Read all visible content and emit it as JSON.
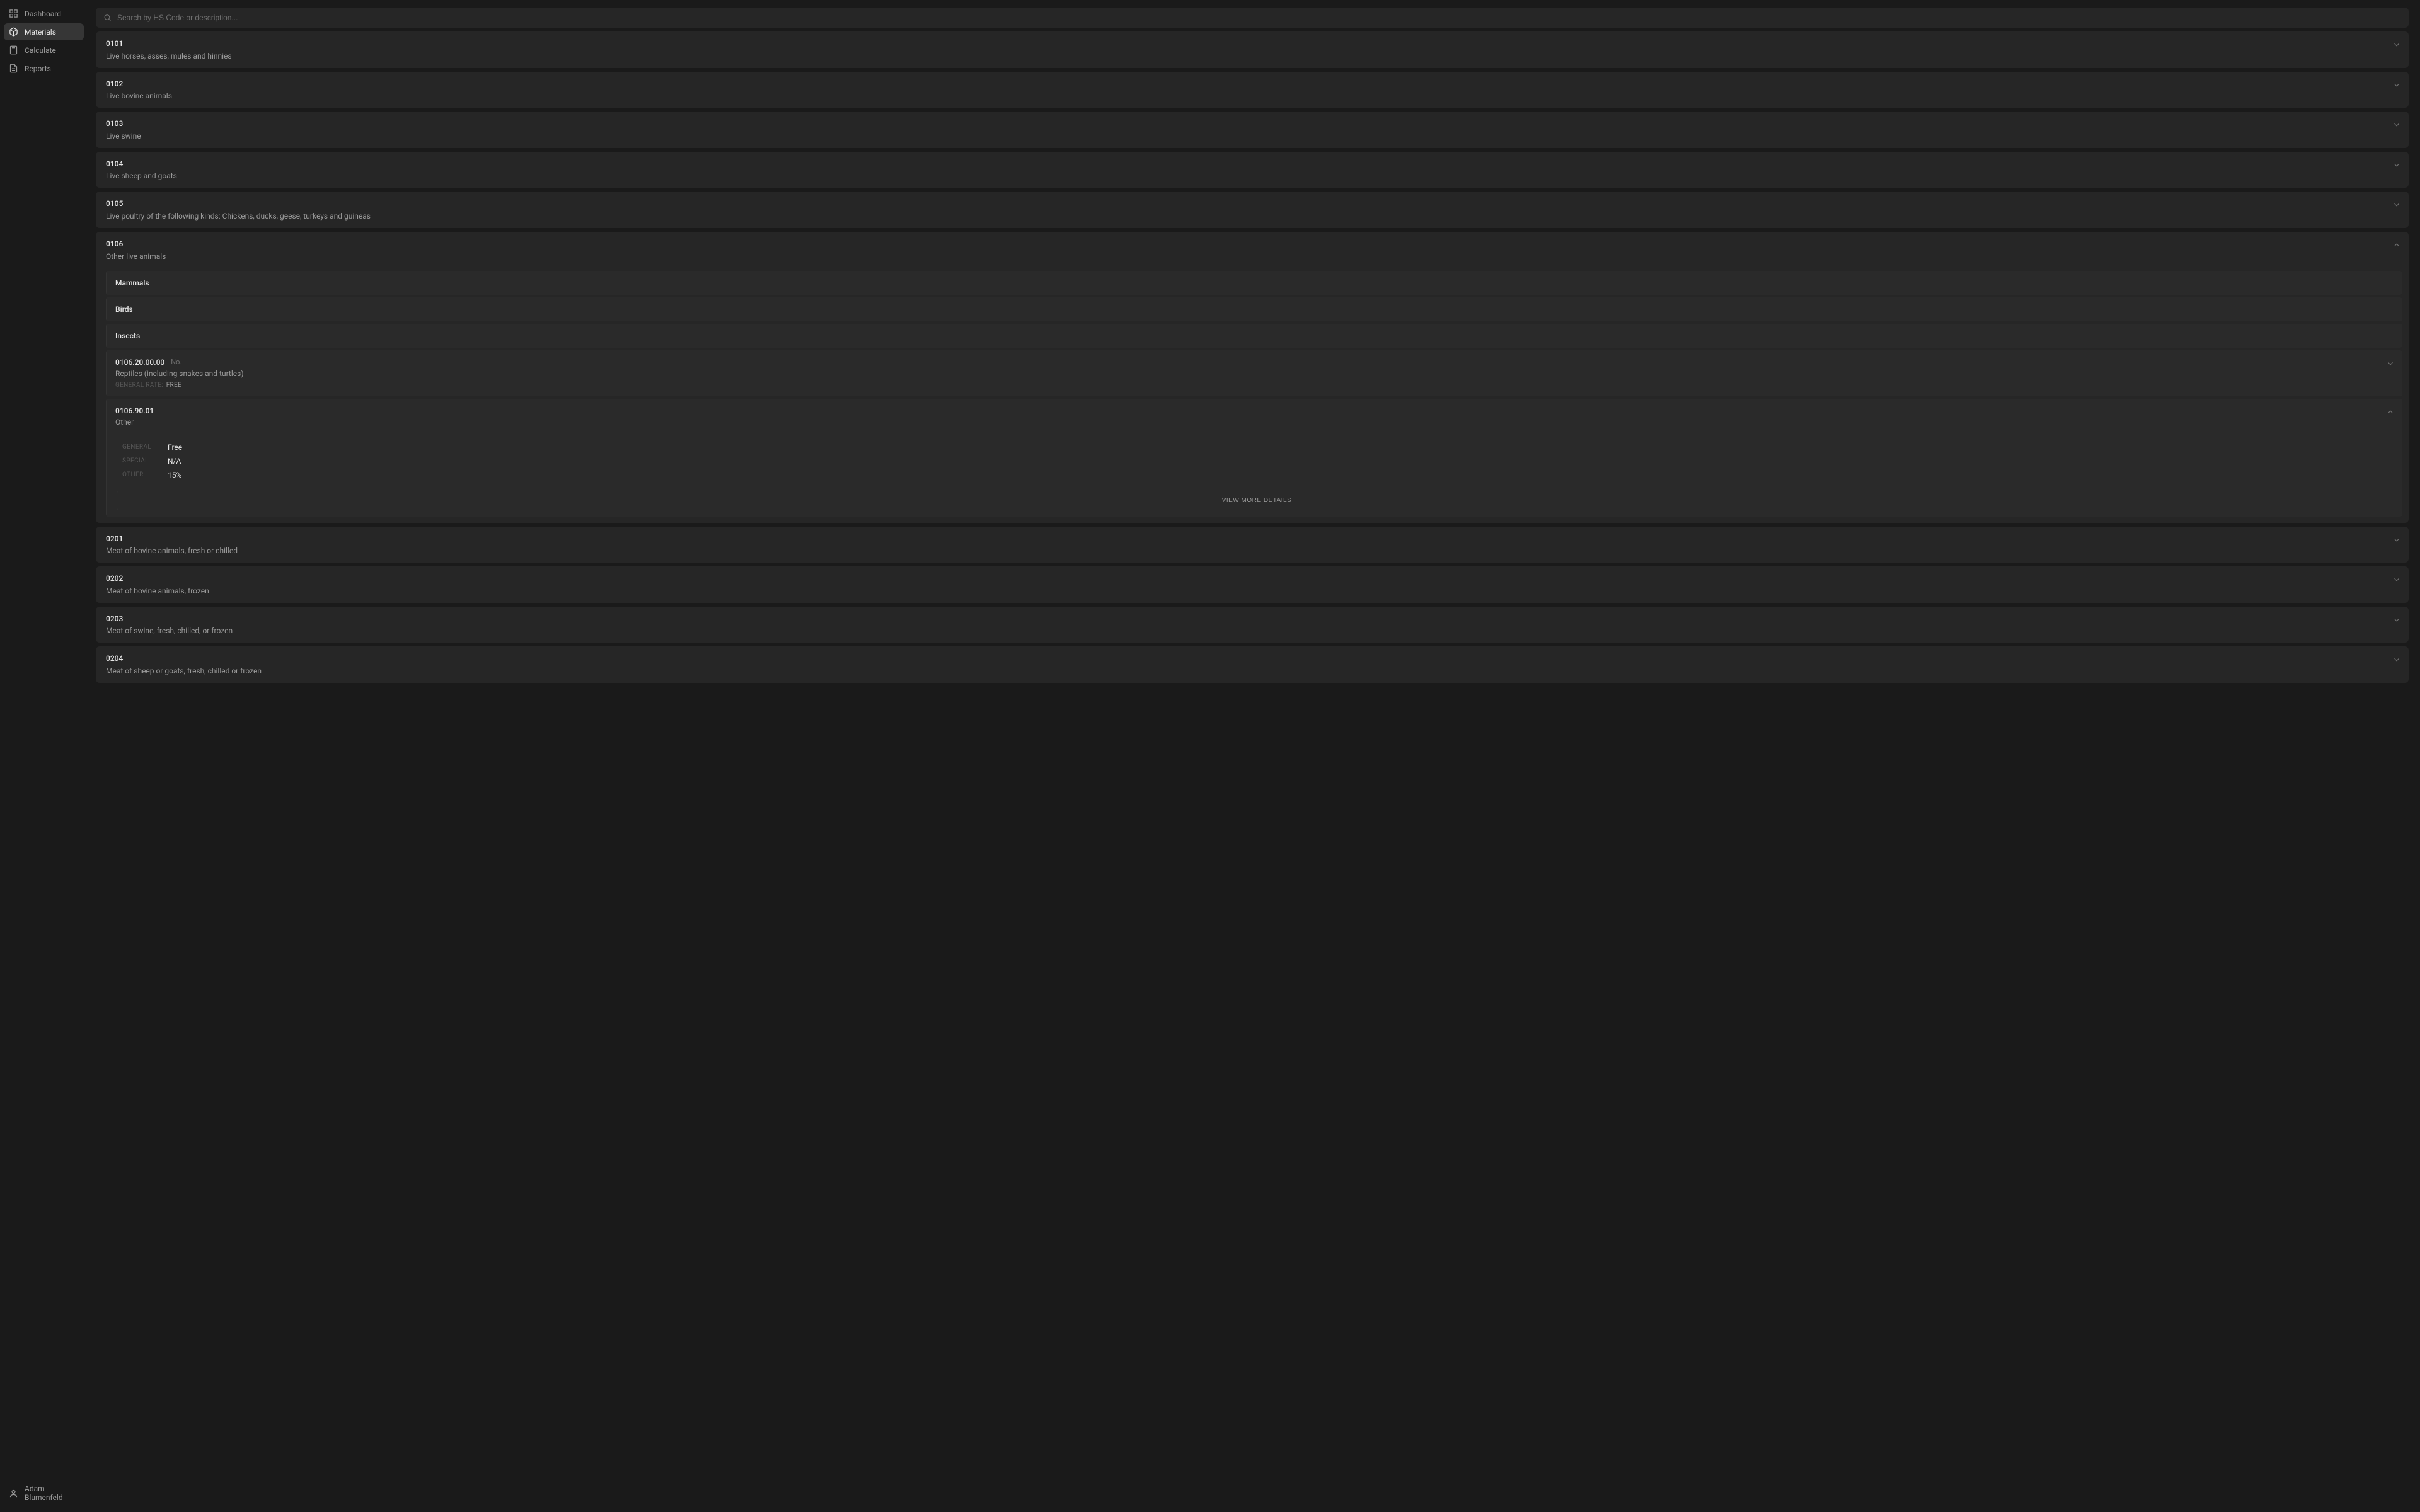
{
  "sidebar": {
    "items": [
      {
        "label": "Dashboard",
        "icon": "dashboard-icon",
        "active": false
      },
      {
        "label": "Materials",
        "icon": "box-icon",
        "active": true
      },
      {
        "label": "Calculate",
        "icon": "calculator-icon",
        "active": false
      },
      {
        "label": "Reports",
        "icon": "file-icon",
        "active": false
      }
    ],
    "user": {
      "name": "Adam Blumenfeld"
    }
  },
  "search": {
    "placeholder": "Search by HS Code or description..."
  },
  "categories": [
    {
      "code": "0101",
      "desc": "Live horses, asses, mules and hinnies",
      "expanded": false
    },
    {
      "code": "0102",
      "desc": "Live bovine animals",
      "expanded": false
    },
    {
      "code": "0103",
      "desc": "Live swine",
      "expanded": false
    },
    {
      "code": "0104",
      "desc": "Live sheep and goats",
      "expanded": false
    },
    {
      "code": "0105",
      "desc": "Live poultry of the following kinds: Chickens, ducks, geese, turkeys and guineas",
      "expanded": false
    },
    {
      "code": "0106",
      "desc": "Other live animals",
      "expanded": true,
      "children": [
        {
          "type": "group",
          "label": "Mammals"
        },
        {
          "type": "group",
          "label": "Birds"
        },
        {
          "type": "group",
          "label": "Insects"
        },
        {
          "type": "leaf",
          "hs": "0106.20.00.00",
          "unit": "No.",
          "desc": "Reptiles (including snakes and turtles)",
          "rate_summary_key": "General Rate:",
          "rate_summary_val": "Free",
          "expanded": false
        },
        {
          "type": "leaf",
          "hs": "0106.90.01",
          "desc": "Other",
          "expanded": true,
          "rates": [
            {
              "k": "General",
              "v": "Free"
            },
            {
              "k": "Special",
              "v": "N/A"
            },
            {
              "k": "Other",
              "v": "15%"
            }
          ],
          "more_label": "View More Details"
        }
      ]
    },
    {
      "code": "0201",
      "desc": "Meat of bovine animals, fresh or chilled",
      "expanded": false
    },
    {
      "code": "0202",
      "desc": "Meat of bovine animals, frozen",
      "expanded": false
    },
    {
      "code": "0203",
      "desc": "Meat of swine, fresh, chilled, or frozen",
      "expanded": false
    },
    {
      "code": "0204",
      "desc": "Meat of sheep or goats, fresh, chilled or frozen",
      "expanded": false
    }
  ]
}
